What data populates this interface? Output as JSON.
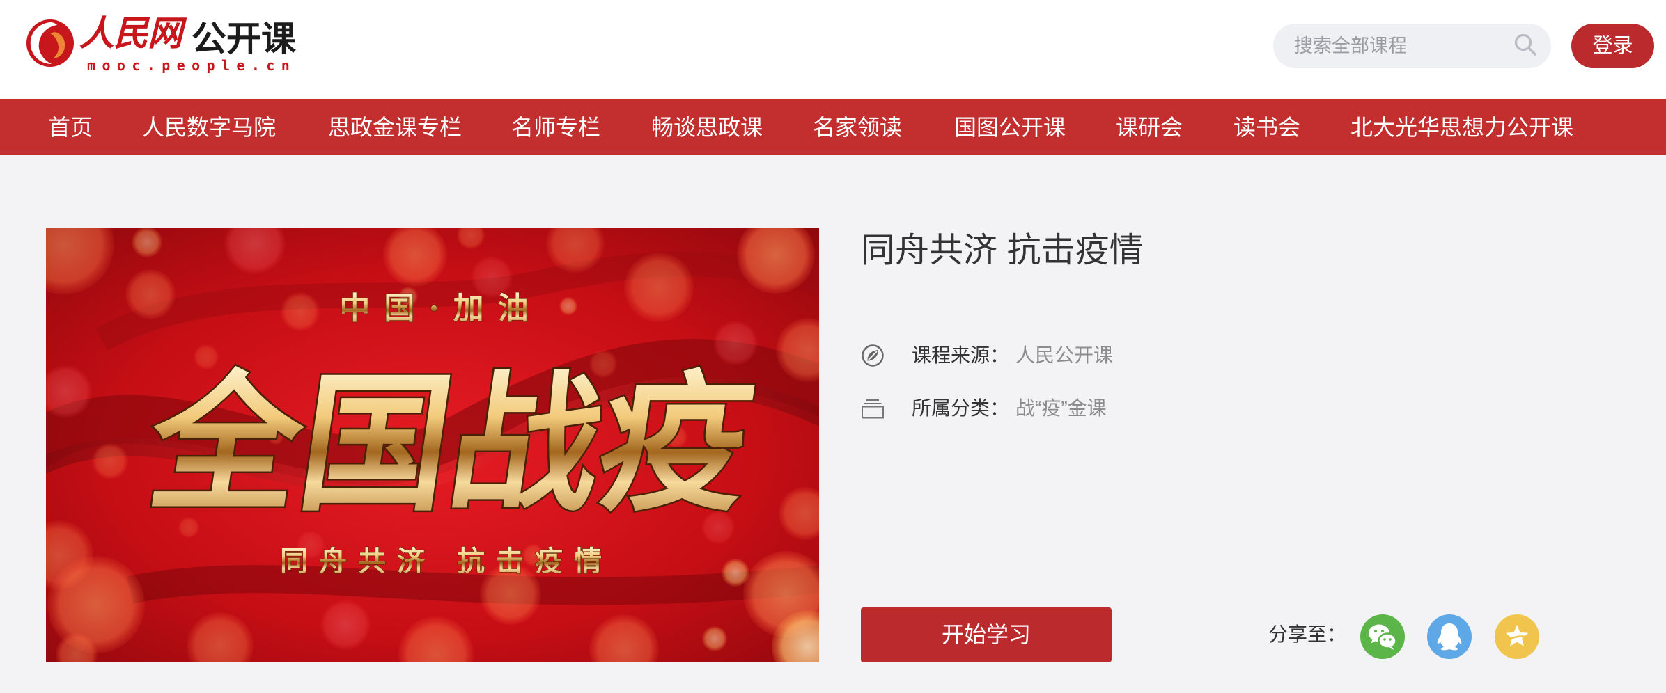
{
  "header": {
    "logo": {
      "brand": "人民网",
      "product": "公开课",
      "domain": "mooc.people.cn",
      "icon": "people-daily-logo-icon"
    },
    "search": {
      "placeholder": "搜索全部课程",
      "icon": "search-icon"
    },
    "login_label": "登录"
  },
  "nav": {
    "items": [
      "首页",
      "人民数字马院",
      "思政金课专栏",
      "名师专栏",
      "畅谈思政课",
      "名家领读",
      "国图公开课",
      "课研会",
      "读书会",
      "北大光华思想力公开课"
    ]
  },
  "course": {
    "poster": {
      "top_line": "中国·加油",
      "headline": "全国战疫",
      "bottom_line": "同舟共济 抗击疫情"
    },
    "title": "同舟共济 抗击疫情",
    "meta": [
      {
        "icon": "source-icon",
        "label": "课程来源：",
        "value": "人民公开课"
      },
      {
        "icon": "category-icon",
        "label": "所属分类：",
        "value": "战“疫”金课"
      }
    ],
    "start_label": "开始学习",
    "share": {
      "label": "分享至：",
      "targets": [
        {
          "icon": "wechat-icon",
          "color": "#5bb548"
        },
        {
          "icon": "qq-icon",
          "color": "#5ea8e8"
        },
        {
          "icon": "qzone-icon",
          "color": "#f1c54d"
        }
      ]
    }
  },
  "colors": {
    "brand_red": "#c32f2f",
    "button_red": "#bb2a2d",
    "page_bg": "#f3f3f6"
  }
}
